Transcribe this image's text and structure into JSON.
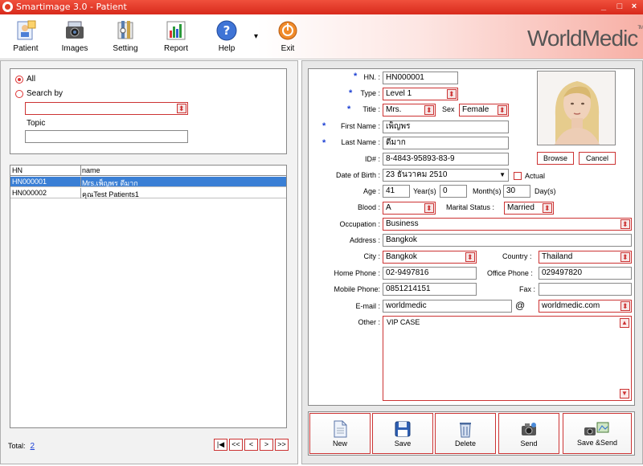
{
  "window": {
    "title": "Smartimage 3.0 - Patient",
    "controls": [
      "_",
      "□",
      "×"
    ]
  },
  "toolbar": {
    "items": [
      {
        "label": "Patient",
        "icon": "patient-icon"
      },
      {
        "label": "Images",
        "icon": "camera-icon"
      },
      {
        "label": "Setting",
        "icon": "setting-icon"
      },
      {
        "label": "Report",
        "icon": "report-chart-icon"
      },
      {
        "label": "Help",
        "icon": "help-icon"
      },
      {
        "label": "Exit",
        "icon": "exit-power-icon"
      }
    ],
    "dropdown_arrow": "▾",
    "logo": "WorldMedic",
    "logo_tm": "TM"
  },
  "search": {
    "all_label": "All",
    "search_by_label": "Search by",
    "search_by_value": "",
    "topic_label": "Topic",
    "topic_value": ""
  },
  "grid": {
    "columns": [
      "HN",
      "name"
    ],
    "rows": [
      {
        "hn": "HN000001",
        "name": "Mrs.เพ็ญพร ดีมาก",
        "selected": true
      },
      {
        "hn": "HN000002",
        "name": "คุณTest Patients1",
        "selected": false
      }
    ]
  },
  "pager": {
    "total_label": "Total:",
    "total_value": "2",
    "buttons": [
      "|◀",
      "<<",
      "<",
      ">",
      ">>"
    ]
  },
  "form": {
    "hn_label": "HN. :",
    "hn_value": "HN000001",
    "type_label": "Type :",
    "type_value": "Level 1",
    "title_label": "Title :",
    "title_value": "Mrs.",
    "sex_label": "Sex",
    "sex_value": "Female",
    "first_name_label": "First Name :",
    "first_name_value": "เพ็ญพร",
    "last_name_label": "Last Name :",
    "last_name_value": "ดีมาก",
    "id_label": "ID# :",
    "id_value": "8-4843-95893-83-9",
    "dob_label": "Date of Birth :",
    "dob_value": "23  ธันวาคม      2510",
    "actual_label": "Actual",
    "age_label": "Age :",
    "age_years": "41",
    "years_label": "Year(s)",
    "age_months": "0",
    "months_label": "Month(s)",
    "age_days": "30",
    "days_label": "Day(s)",
    "blood_label": "Blood :",
    "blood_value": "A",
    "marital_label": "Marital Status :",
    "marital_value": "Married",
    "occupation_label": "Occupation :",
    "occupation_value": "Business",
    "address_label": "Address :",
    "address_value": "Bangkok",
    "city_label": "City :",
    "city_value": "Bangkok",
    "country_label": "Country :",
    "country_value": "Thailand",
    "home_phone_label": "Home Phone :",
    "home_phone_value": "02-9497816",
    "office_phone_label": "Office Phone :",
    "office_phone_value": "029497820",
    "mobile_label": "Mobile Phone:",
    "mobile_value": "0851214151",
    "fax_label": "Fax :",
    "fax_value": "",
    "email_label": "E-mail :",
    "email_user": "worldmedic",
    "at_sign": "@",
    "email_domain": "worldmedic.com",
    "other_label": "Other :",
    "other_value": "VIP CASE",
    "browse_label": "Browse",
    "cancel_label": "Cancel"
  },
  "actions": [
    {
      "label": "New",
      "icon": "new-document-icon"
    },
    {
      "label": "Save",
      "icon": "save-disk-icon"
    },
    {
      "label": "Delete",
      "icon": "delete-recycle-icon"
    },
    {
      "label": "Send",
      "icon": "send-camera-icon"
    },
    {
      "label": "Save &Send",
      "icon": "save-send-icon"
    }
  ]
}
